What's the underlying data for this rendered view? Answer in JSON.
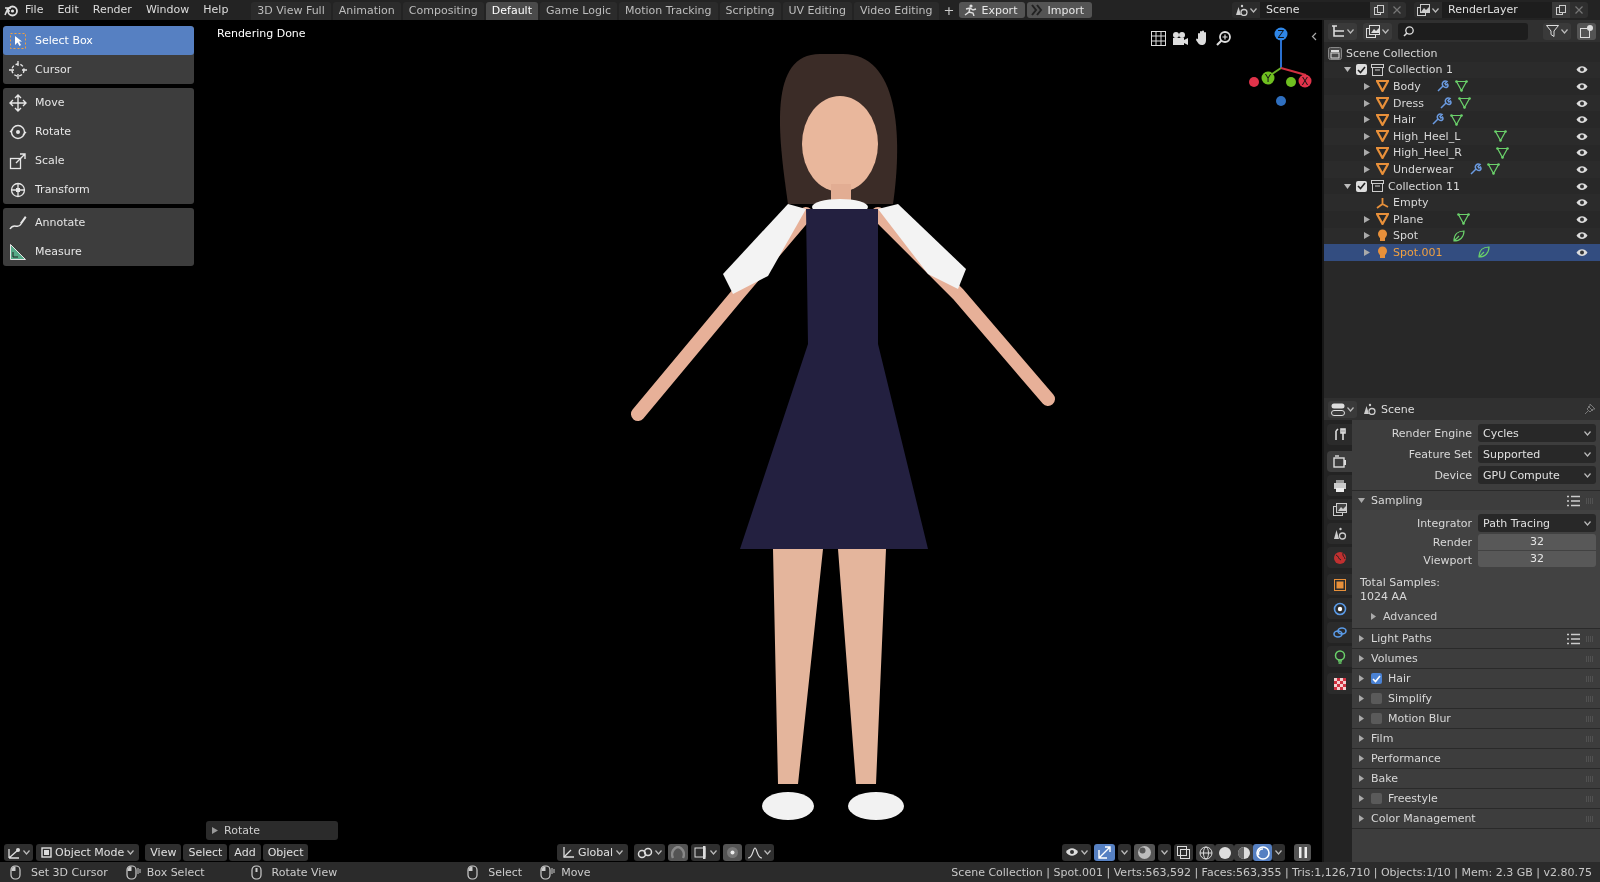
{
  "menu": [
    "File",
    "Edit",
    "Render",
    "Window",
    "Help"
  ],
  "workspaces": [
    {
      "label": "3D View Full",
      "selected": false
    },
    {
      "label": "Animation",
      "selected": false
    },
    {
      "label": "Compositing",
      "selected": false
    },
    {
      "label": "Default",
      "selected": true
    },
    {
      "label": "Game Logic",
      "selected": false
    },
    {
      "label": "Motion Tracking",
      "selected": false
    },
    {
      "label": "Scripting",
      "selected": false
    },
    {
      "label": "UV Editing",
      "selected": false
    },
    {
      "label": "Video Editing",
      "selected": false
    }
  ],
  "add_workspace": "+",
  "addon_buttons": [
    {
      "label": "Export",
      "kind": "export"
    },
    {
      "label": "Import",
      "kind": "import"
    }
  ],
  "scene": {
    "name": "Scene"
  },
  "view_layer": {
    "name": "RenderLayer"
  },
  "toolbar": [
    [
      {
        "label": "Select Box",
        "kind": "select_box",
        "selected": true
      },
      {
        "label": "Cursor",
        "kind": "cursor",
        "selected": false
      }
    ],
    [
      {
        "label": "Move",
        "kind": "move",
        "selected": false
      },
      {
        "label": "Rotate",
        "kind": "rotate",
        "selected": false
      },
      {
        "label": "Scale",
        "kind": "scale",
        "selected": false
      },
      {
        "label": "Transform",
        "kind": "transform",
        "selected": false
      }
    ],
    [
      {
        "label": "Annotate",
        "kind": "annotate",
        "selected": false
      },
      {
        "label": "Measure",
        "kind": "measure",
        "selected": false
      }
    ]
  ],
  "viewport": {
    "status": "Rendering Done",
    "last_operator": "Rotate",
    "axes": [
      "Z",
      "Y",
      "X"
    ]
  },
  "viewport_header": {
    "mode": "Object Mode",
    "menus": [
      "View",
      "Select",
      "Add",
      "Object"
    ],
    "orientation": "Global",
    "shading": [
      {
        "kind": "wireframe",
        "selected": false
      },
      {
        "kind": "solid",
        "selected": false
      },
      {
        "kind": "material",
        "selected": false
      },
      {
        "kind": "rendered",
        "selected": true
      }
    ]
  },
  "outliner": {
    "root": "Scene Collection",
    "collections": [
      {
        "name": "Collection 1",
        "checked": true,
        "expanded": true,
        "objects": [
          {
            "name": "Body",
            "kind": "mesh",
            "modifier": true,
            "selected": false
          },
          {
            "name": "Dress",
            "kind": "mesh",
            "modifier": true,
            "selected": false
          },
          {
            "name": "Hair",
            "kind": "mesh",
            "modifier": true,
            "selected": false
          },
          {
            "name": "High_Heel_L",
            "kind": "mesh",
            "modifier": false,
            "selected": false
          },
          {
            "name": "High_Heel_R",
            "kind": "mesh",
            "modifier": false,
            "selected": false
          },
          {
            "name": "Underwear",
            "kind": "mesh",
            "modifier": true,
            "selected": false
          }
        ]
      },
      {
        "name": "Collection 11",
        "checked": true,
        "expanded": true,
        "objects": [
          {
            "name": "Empty",
            "kind": "empty",
            "modifier": false,
            "selected": false
          },
          {
            "name": "Plane",
            "kind": "mesh",
            "modifier": false,
            "selected": false
          },
          {
            "name": "Spot",
            "kind": "light",
            "modifier": false,
            "selected": false
          },
          {
            "name": "Spot.001",
            "kind": "light",
            "modifier": false,
            "selected": true
          }
        ]
      }
    ]
  },
  "properties": {
    "context": "Scene",
    "tabs": [
      [
        {
          "kind": "tool",
          "selected": false
        }
      ],
      [
        {
          "kind": "render",
          "selected": true
        },
        {
          "kind": "output",
          "selected": false
        },
        {
          "kind": "view_layer",
          "selected": false
        },
        {
          "kind": "scene",
          "selected": false
        },
        {
          "kind": "world",
          "selected": false
        }
      ],
      [
        {
          "kind": "object",
          "selected": false
        },
        {
          "kind": "physics",
          "selected": false
        },
        {
          "kind": "constraints",
          "selected": false
        },
        {
          "kind": "object_data",
          "selected": false
        }
      ],
      [
        {
          "kind": "texture",
          "selected": false
        }
      ]
    ],
    "fields": [
      {
        "label": "Render Engine",
        "value": "Cycles"
      },
      {
        "label": "Feature Set",
        "value": "Supported"
      },
      {
        "label": "Device",
        "value": "GPU Compute"
      }
    ],
    "sampling": {
      "label": "Sampling",
      "expanded": true,
      "integrator": {
        "label": "Integrator",
        "value": "Path Tracing"
      },
      "samples": [
        {
          "label": "Render",
          "value": "32"
        },
        {
          "label": "Viewport",
          "value": "32"
        }
      ],
      "total_label": "Total Samples:",
      "total_value": "1024 AA",
      "advanced": {
        "label": "Advanced",
        "expanded": false
      }
    },
    "panels": [
      {
        "label": "Light Paths",
        "kind": "plain",
        "presets": true,
        "expanded": false
      },
      {
        "label": "Volumes",
        "kind": "plain",
        "presets": false,
        "expanded": false
      },
      {
        "label": "Hair",
        "kind": "toggle",
        "checked": true,
        "presets": false,
        "expanded": false
      },
      {
        "label": "Simplify",
        "kind": "toggle",
        "checked": false,
        "presets": false,
        "expanded": false
      },
      {
        "label": "Motion Blur",
        "kind": "toggle",
        "checked": false,
        "presets": false,
        "expanded": false
      },
      {
        "label": "Film",
        "kind": "plain",
        "presets": false,
        "expanded": false
      },
      {
        "label": "Performance",
        "kind": "plain",
        "presets": false,
        "expanded": false
      },
      {
        "label": "Bake",
        "kind": "plain",
        "presets": false,
        "expanded": false
      },
      {
        "label": "Freestyle",
        "kind": "toggle",
        "checked": false,
        "presets": false,
        "expanded": false
      },
      {
        "label": "Color Management",
        "kind": "plain",
        "presets": false,
        "expanded": false
      }
    ]
  },
  "status_bar": {
    "hints": [
      {
        "label": "Set 3D Cursor",
        "kind": "left"
      },
      {
        "label": "Box Select",
        "kind": "left_drag"
      },
      {
        "label": "Rotate View",
        "kind": "middle"
      },
      {
        "label": "Select",
        "kind": "left"
      },
      {
        "label": "Move",
        "kind": "left_drag"
      }
    ],
    "stats": "Scene Collection | Spot.001 | Verts:563,592 | Faces:563,355 | Tris:1,126,710 | Objects:1/10 | Mem: 2.3 GB | v2.80.75"
  }
}
